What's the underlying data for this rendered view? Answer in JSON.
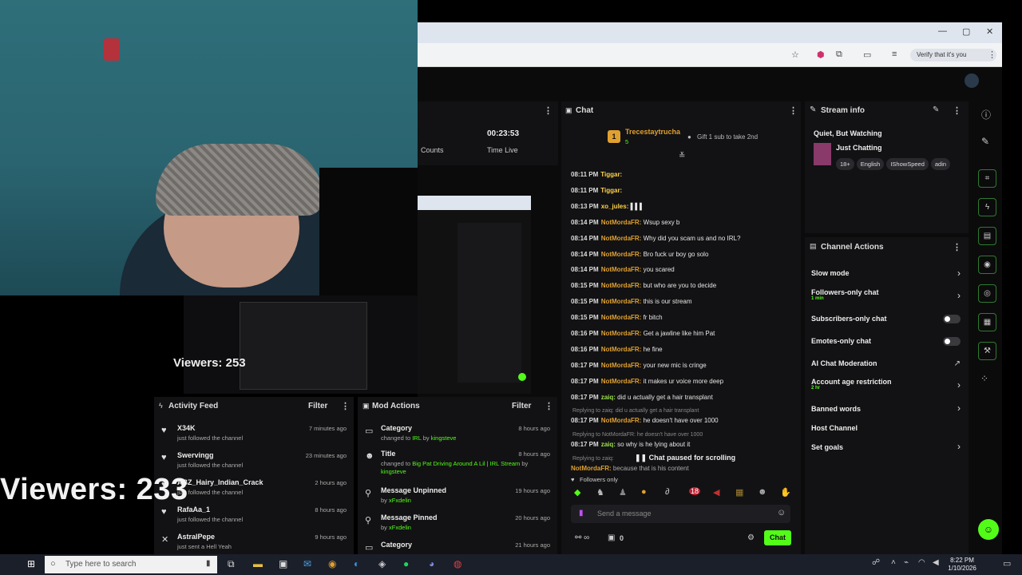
{
  "overlay": {
    "viewers_small": "Viewers: 253",
    "viewers_big": "Viewers: 233"
  },
  "browser": {
    "verify_label": "Verify that it's you",
    "min": "—",
    "max": "▢",
    "close": "✕"
  },
  "stats": {
    "counts_label": "Counts",
    "time_value": "00:23:53",
    "time_label": "Time Live"
  },
  "chat": {
    "title": "Chat",
    "pinned_user": "Trecestaytrucha",
    "pinned_count": "5",
    "gift_text": "Gift 1 sub to take 2nd",
    "messages": [
      {
        "time": "08:11 PM",
        "user": "Tiggar:",
        "text": ""
      },
      {
        "time": "08:11 PM",
        "user": "Tiggar:",
        "text": ""
      },
      {
        "time": "08:13 PM",
        "user": "xo_jules:",
        "text": "▌▌▌"
      },
      {
        "time": "08:14 PM",
        "user": "NotMordaFR:",
        "text": "Wsup sexy b"
      },
      {
        "time": "08:14 PM",
        "user": "NotMordaFR:",
        "text": "Why did you scam us and no IRL?"
      },
      {
        "time": "08:14 PM",
        "user": "NotMordaFR:",
        "text": "Bro fuck ur boy go solo"
      },
      {
        "time": "08:14 PM",
        "user": "NotMordaFR:",
        "text": "you scared"
      },
      {
        "time": "08:15 PM",
        "user": "NotMordaFR:",
        "text": "but who are you to decide"
      },
      {
        "time": "08:15 PM",
        "user": "NotMordaFR:",
        "text": "this is our stream"
      },
      {
        "time": "08:15 PM",
        "user": "NotMordaFR:",
        "text": "fr bitch"
      },
      {
        "time": "08:16 PM",
        "user": "NotMordaFR:",
        "text": "Get a jawline like him Pat"
      },
      {
        "time": "08:16 PM",
        "user": "NotMordaFR:",
        "text": "he fine"
      },
      {
        "time": "08:17 PM",
        "user": "NotMordaFR:",
        "text": "your new mic is cringe"
      },
      {
        "time": "08:17 PM",
        "user": "NotMordaFR:",
        "text": "it makes ur voice more deep"
      },
      {
        "time": "08:17 PM",
        "user": "zaiq:",
        "text": "did u actually get a hair transplant"
      }
    ],
    "reply1": "Replying to zaiq: did u actually get a hair transplant",
    "reply1_time": "08:17 PM",
    "reply1_user": "NotMordaFR:",
    "reply1_text": "he doesn't have over 1000",
    "reply2": "Replying to NotMordaFR: he doesn't have over 1000",
    "reply2_time": "08:17 PM",
    "reply2_user": "zaiq:",
    "reply2_text": "so why is he lying about it",
    "reply3": "Replying to zaiq:",
    "reply3_user": "NotMordaFR:",
    "reply3_text": "because that is his content",
    "paused": "Chat paused for scrolling",
    "followers_only": "Followers only",
    "placeholder": "Send a message",
    "count": "0",
    "send_label": "Chat"
  },
  "stream_info": {
    "title": "Stream info",
    "stream_title": "Quiet, But Watching",
    "category": "Just Chatting",
    "tags": [
      "18+",
      "English",
      "IShowSpeed",
      "adin"
    ]
  },
  "channel_actions": {
    "title": "Channel Actions",
    "items": [
      {
        "label": "Slow mode",
        "sub": ""
      },
      {
        "label": "Followers-only chat",
        "sub": "1 min"
      },
      {
        "label": "Subscribers-only chat",
        "sub": ""
      },
      {
        "label": "Emotes-only chat",
        "sub": ""
      },
      {
        "label": "AI Chat Moderation",
        "sub": ""
      },
      {
        "label": "Account age restriction",
        "sub": "2 hr"
      },
      {
        "label": "Banned words",
        "sub": ""
      },
      {
        "label": "Host Channel",
        "sub": ""
      },
      {
        "label": "Set goals",
        "sub": ""
      }
    ]
  },
  "activity": {
    "title": "Activity Feed",
    "filter": "Filter",
    "items": [
      {
        "name": "X34K",
        "sub": "just followed the channel",
        "time": "7 minutes ago"
      },
      {
        "name": "Swervingg",
        "sub": "just followed the channel",
        "time": "23 minutes ago"
      },
      {
        "name": "ABZ_Hairy_Indian_Crack",
        "sub": "just followed the channel",
        "time": "2 hours ago"
      },
      {
        "name": "RafaAa_1",
        "sub": "just followed the channel",
        "time": "8 hours ago"
      },
      {
        "name": "AstralPepe",
        "sub": "just sent a Hell Yeah",
        "time": "9 hours ago"
      }
    ]
  },
  "mod_actions": {
    "title": "Mod Actions",
    "filter": "Filter",
    "items": [
      {
        "name": "Category",
        "sub_a": "changed to",
        "sub_b": "IRL",
        "sub_c": "by",
        "sub_d": "kingsteve",
        "time": "8 hours ago"
      },
      {
        "name": "Title",
        "sub_a": "changed to",
        "sub_b": "Big Pat Driving Around A Lil | IRL Stream",
        "sub_c": "by",
        "sub_d": "kingsteve",
        "time": "8 hours ago"
      },
      {
        "name": "Message Unpinned",
        "sub_a": "by",
        "sub_b": "",
        "sub_c": "",
        "sub_d": "xFxdelin",
        "time": "19 hours ago"
      },
      {
        "name": "Message Pinned",
        "sub_a": "by",
        "sub_b": "",
        "sub_c": "",
        "sub_d": "xFxdelin",
        "time": "20 hours ago"
      },
      {
        "name": "Category",
        "sub_a": "",
        "sub_b": "",
        "sub_c": "",
        "sub_d": "",
        "time": "21 hours ago"
      }
    ]
  },
  "taskbar": {
    "search_placeholder": "Type here to search",
    "time": "8:22 PM",
    "date": "1/10/2026"
  }
}
